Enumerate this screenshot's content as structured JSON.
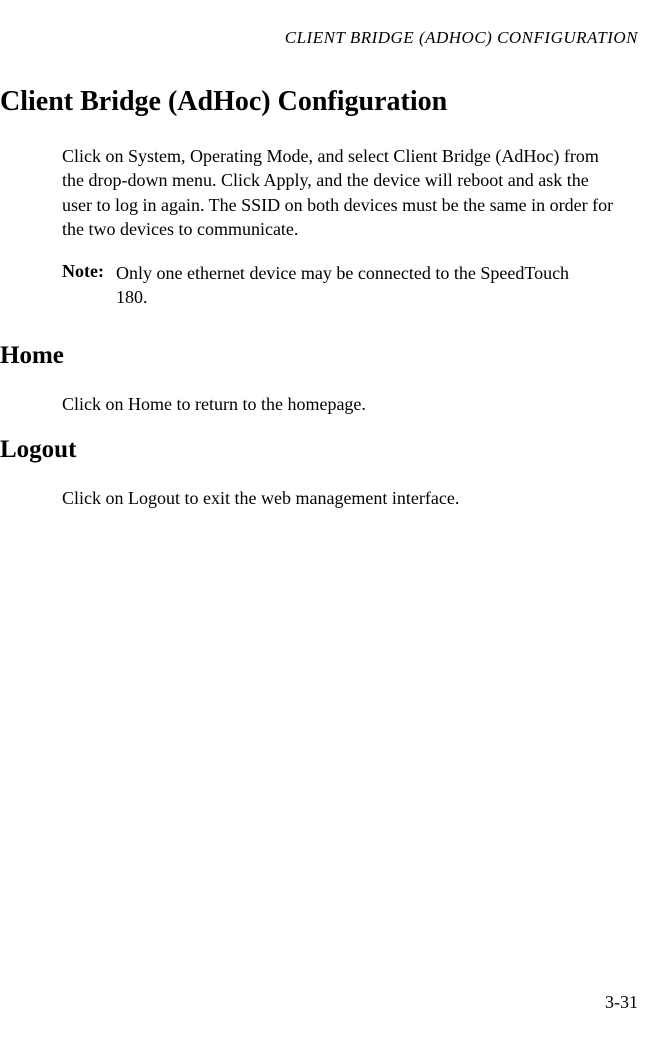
{
  "running_header": "CLIENT BRIDGE (ADHOC) CONFIGURATION",
  "heading_main": "Client Bridge (AdHoc) Configuration",
  "paragraph_main": "Click on System, Operating Mode, and select Client Bridge (AdHoc) from the drop-down menu. Click Apply, and the device will reboot and ask the user to log in again. The SSID on both devices must be the same in order for the two devices to communicate.",
  "note_label": "Note:",
  "note_text": "Only one ethernet device may be connected to the SpeedTouch 180.",
  "section_home_heading": "Home",
  "section_home_text": "Click on Home to return to the homepage.",
  "section_logout_heading": "Logout",
  "section_logout_text": "Click on Logout to exit the web management interface.",
  "page_number": "3-31"
}
